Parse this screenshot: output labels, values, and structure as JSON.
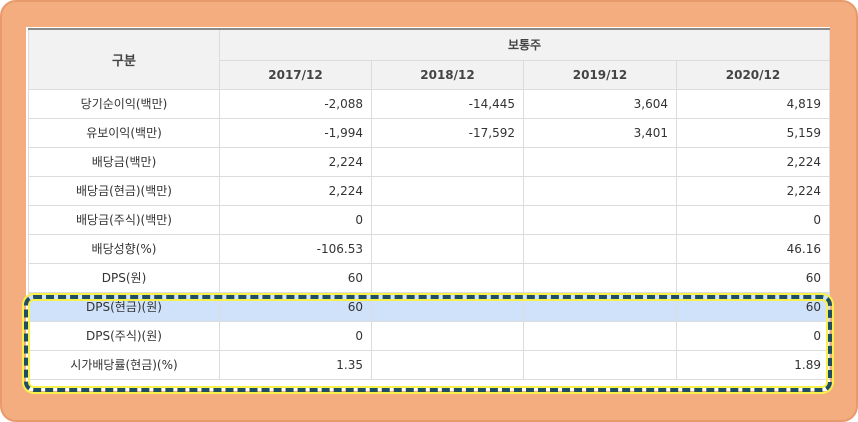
{
  "header": {
    "corner": "구분",
    "group": "보통주",
    "years": [
      "2017/12",
      "2018/12",
      "2019/12",
      "2020/12"
    ]
  },
  "rows": [
    {
      "label": "당기순이익(백만)",
      "v": [
        "-2,088",
        "-14,445",
        "3,604",
        "4,819"
      ]
    },
    {
      "label": "유보이익(백만)",
      "v": [
        "-1,994",
        "-17,592",
        "3,401",
        "5,159"
      ]
    },
    {
      "label": "배당금(백만)",
      "v": [
        "2,224",
        "",
        "",
        "2,224"
      ]
    },
    {
      "label": "배당금(현금)(백만)",
      "v": [
        "2,224",
        "",
        "",
        "2,224"
      ]
    },
    {
      "label": "배당금(주식)(백만)",
      "v": [
        "0",
        "",
        "",
        "0"
      ]
    },
    {
      "label": "배당성향(%)",
      "v": [
        "-106.53",
        "",
        "",
        "46.16"
      ]
    },
    {
      "label": "DPS(원)",
      "v": [
        "60",
        "",
        "",
        "60"
      ]
    },
    {
      "label": "DPS(현금)(원)",
      "v": [
        "60",
        "",
        "",
        "60"
      ]
    },
    {
      "label": "DPS(주식)(원)",
      "v": [
        "0",
        "",
        "",
        "0"
      ]
    },
    {
      "label": "시가배당률(현금)(%)",
      "v": [
        "1.35",
        "",
        "",
        "1.89"
      ]
    }
  ],
  "colors": {
    "frame": "#f4ad7f",
    "highlight_row": "#cfe2fa",
    "dash_border": "#1f4e63",
    "dash_glow": "#f8f14a"
  }
}
